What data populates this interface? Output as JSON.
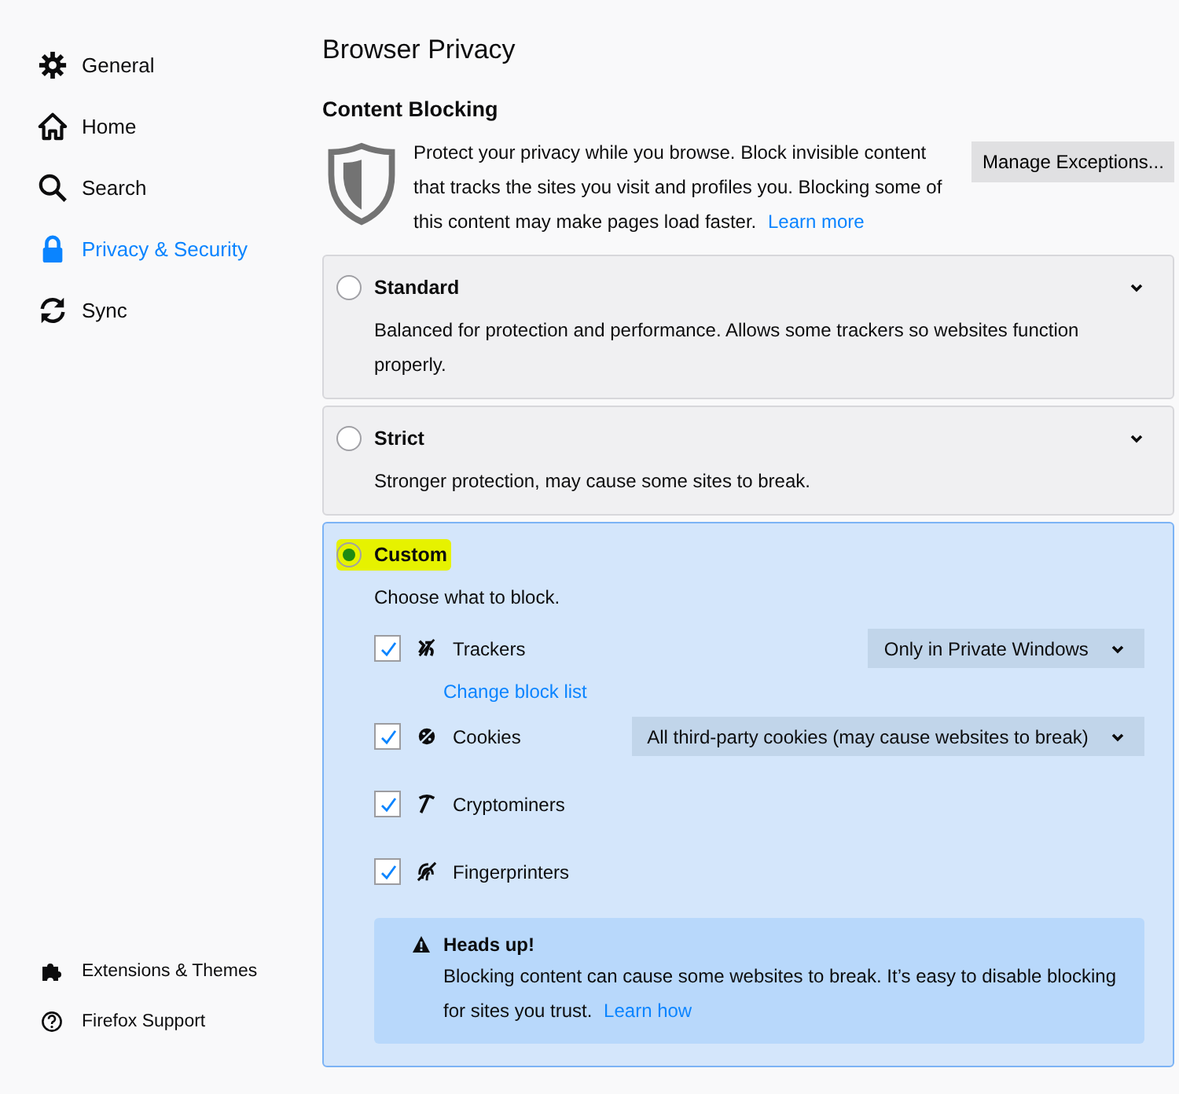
{
  "sidebar": {
    "items": [
      {
        "kind": "gear",
        "label": "General",
        "selected": false
      },
      {
        "kind": "home",
        "label": "Home",
        "selected": false
      },
      {
        "kind": "search",
        "label": "Search",
        "selected": false
      },
      {
        "kind": "lock",
        "label": "Privacy & Security",
        "selected": true
      },
      {
        "kind": "sync",
        "label": "Sync",
        "selected": false
      }
    ],
    "footer": [
      {
        "kind": "puzzle",
        "label": "Extensions & Themes"
      },
      {
        "kind": "help",
        "label": "Firefox Support"
      }
    ]
  },
  "page_title": "Browser Privacy",
  "content_blocking": {
    "heading": "Content Blocking",
    "description": "Protect your privacy while you browse. Block invisible content that tracks the sites you visit and profiles you. Blocking some of this content may make pages load faster.",
    "learn_more": "Learn more",
    "button": "Manage Exceptions..."
  },
  "options": [
    {
      "label": "Standard",
      "selected": false,
      "highlighted": false,
      "expanded": false,
      "description": "Balanced for protection and performance. Allows some trackers so websites function properly."
    },
    {
      "label": "Strict",
      "selected": false,
      "highlighted": false,
      "expanded": false,
      "description": "Stronger protection, may cause some sites to break."
    },
    {
      "label": "Custom",
      "selected": true,
      "highlighted": true,
      "expanded": true,
      "description": "Choose what to block.",
      "items": [
        {
          "kind": "trackers",
          "label": "Trackers",
          "checked": true,
          "dropdown": "Only in Private Windows",
          "link": "Change block list"
        },
        {
          "kind": "cookies",
          "label": "Cookies",
          "checked": true,
          "dropdown": "All third-party cookies (may cause websites to break)"
        },
        {
          "kind": "cryptominers",
          "label": "Cryptominers",
          "checked": true
        },
        {
          "kind": "fingerprinters",
          "label": "Fingerprinters",
          "checked": true
        }
      ],
      "warning": {
        "title": "Heads up!",
        "text": "Blocking content can cause some websites to break. It’s easy to disable blocking for sites you trust.",
        "link": "Learn how"
      }
    }
  ]
}
